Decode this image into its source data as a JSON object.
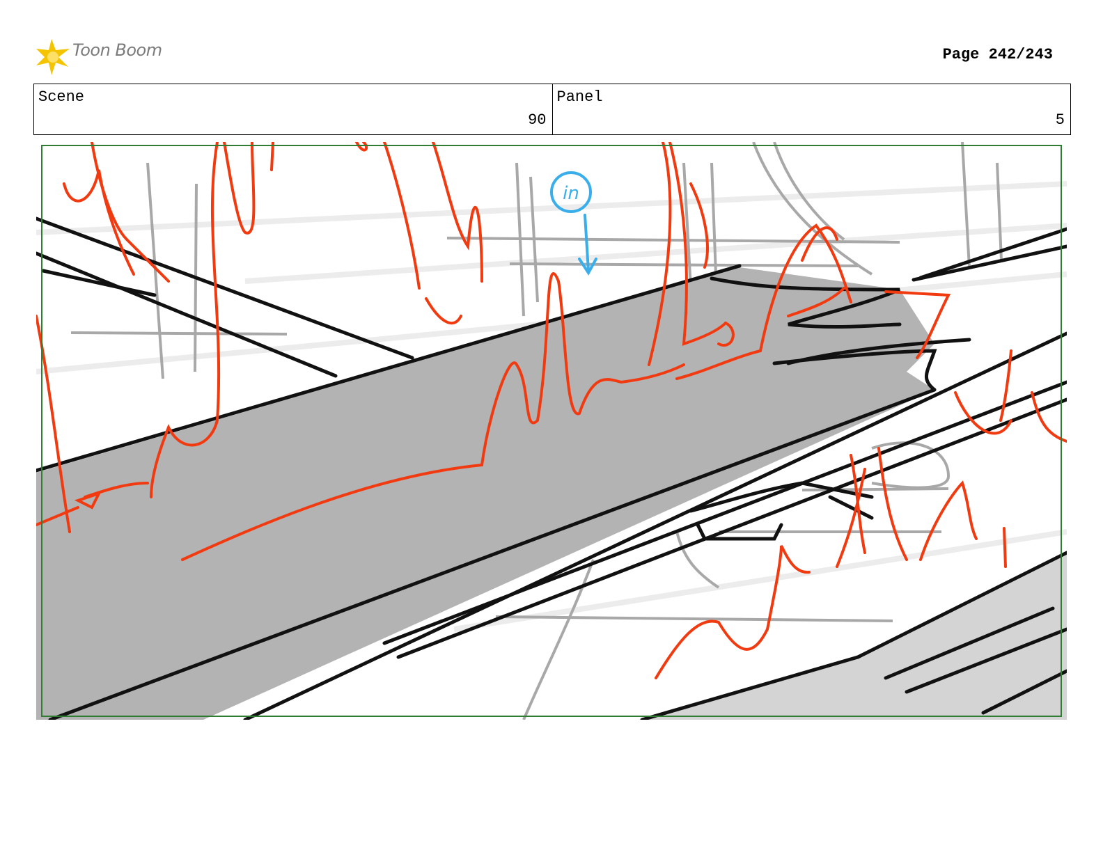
{
  "header": {
    "logo_text": "Toon Boom",
    "page_label": "Page 242/243"
  },
  "info": {
    "scene_label": "Scene",
    "scene_value": "90",
    "panel_label": "Panel",
    "panel_value": "5"
  },
  "sketch": {
    "annotation_text": "in"
  },
  "colors": {
    "fire": "#f23a10",
    "annotation": "#3aaeea",
    "frame": "#2e7d32",
    "sky_beam": "#b3b3b3"
  }
}
